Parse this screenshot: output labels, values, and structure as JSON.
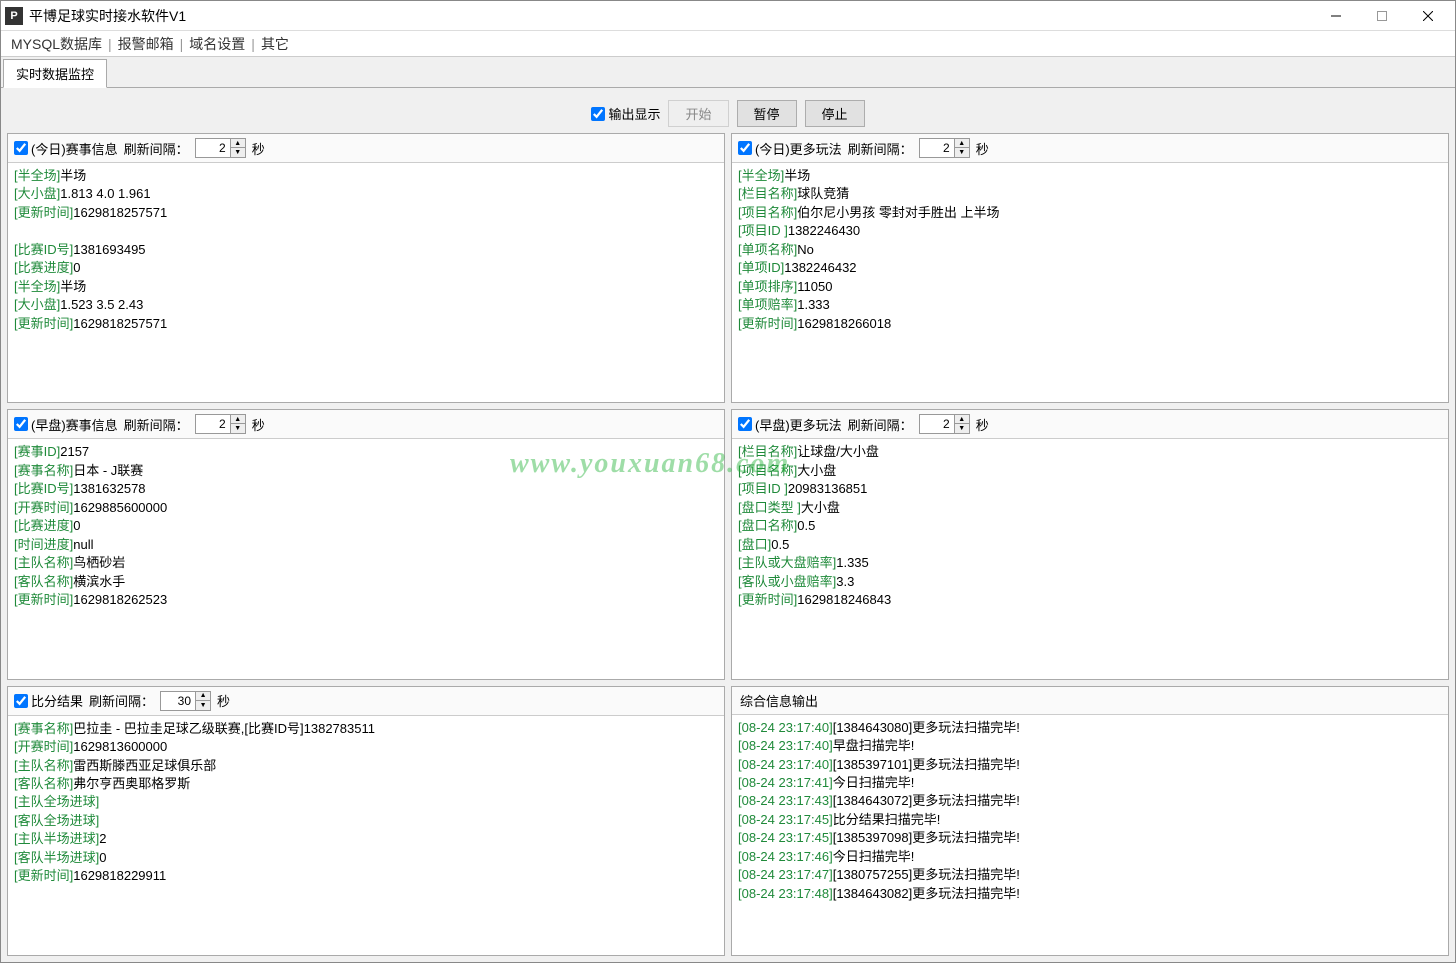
{
  "window": {
    "icon_letter": "P",
    "title": "平博足球实时接水软件V1"
  },
  "menu": {
    "items": [
      "MYSQL数据库",
      "报警邮箱",
      "域名设置",
      "其它"
    ]
  },
  "tab": {
    "active": "实时数据监控"
  },
  "top": {
    "output_display": "输出显示",
    "btn_start": "开始",
    "btn_pause": "暂停",
    "btn_stop": "停止"
  },
  "panels": {
    "today_match": {
      "title": "(今日)赛事信息",
      "interval_label": "刷新间隔：",
      "interval_val": "2",
      "unit": "秒",
      "lines": [
        {
          "k": "[半全场]",
          "v": "半场"
        },
        {
          "k": "[大小盘]",
          "v": "1.813 4.0 1.961"
        },
        {
          "k": "[更新时间]",
          "v": "1629818257571"
        },
        {
          "k": "",
          "v": ""
        },
        {
          "k": "[比赛ID号]",
          "v": "1381693495"
        },
        {
          "k": "[比赛进度]",
          "v": "0"
        },
        {
          "k": "[半全场]",
          "v": "半场"
        },
        {
          "k": "[大小盘]",
          "v": "1.523 3.5 2.43"
        },
        {
          "k": "[更新时间]",
          "v": "1629818257571"
        }
      ]
    },
    "today_more": {
      "title": "(今日)更多玩法",
      "interval_label": "刷新间隔：",
      "interval_val": "2",
      "unit": "秒",
      "lines": [
        {
          "k": "[半全场]",
          "v": "半场"
        },
        {
          "k": "[栏目名称]",
          "v": "球队竞猜"
        },
        {
          "k": "[项目名称]",
          "v": "伯尔尼小男孩 零封对手胜出 上半场"
        },
        {
          "k": "[项目ID ]",
          "v": "1382246430"
        },
        {
          "k": "[单项名称]",
          "v": "No"
        },
        {
          "k": "[单项ID]",
          "v": "1382246432"
        },
        {
          "k": "[单项排序]",
          "v": "11050"
        },
        {
          "k": "[单项赔率]",
          "v": "1.333"
        },
        {
          "k": "[更新时间]",
          "v": "1629818266018"
        }
      ]
    },
    "early_match": {
      "title": "(早盘)赛事信息",
      "interval_label": "刷新间隔：",
      "interval_val": "2",
      "unit": "秒",
      "lines": [
        {
          "k": "[赛事ID]",
          "v": "2157"
        },
        {
          "k": "[赛事名称]",
          "v": "日本 - J联赛"
        },
        {
          "k": "[比赛ID号]",
          "v": "1381632578"
        },
        {
          "k": "[开赛时间]",
          "v": "1629885600000"
        },
        {
          "k": "[比赛进度]",
          "v": "0"
        },
        {
          "k": "[时间进度]",
          "v": "null"
        },
        {
          "k": "[主队名称]",
          "v": "鸟栖砂岩"
        },
        {
          "k": "[客队名称]",
          "v": "横滨水手"
        },
        {
          "k": "[更新时间]",
          "v": "1629818262523"
        }
      ]
    },
    "early_more": {
      "title": "(早盘)更多玩法",
      "interval_label": "刷新间隔：",
      "interval_val": "2",
      "unit": "秒",
      "lines": [
        {
          "k": "[栏目名称]",
          "v": "让球盘/大小盘"
        },
        {
          "k": "[项目名称]",
          "v": "大小盘"
        },
        {
          "k": "[项目ID ]",
          "v": "20983136851"
        },
        {
          "k": "[盘口类型 ]",
          "v": "大小盘"
        },
        {
          "k": "[盘口名称]",
          "v": "0.5"
        },
        {
          "k": "[盘口]",
          "v": "0.5"
        },
        {
          "k": "[主队或大盘赔率]",
          "v": "1.335"
        },
        {
          "k": "[客队或小盘赔率]",
          "v": "3.3"
        },
        {
          "k": "[更新时间]",
          "v": "1629818246843"
        }
      ]
    },
    "score": {
      "title": "比分结果",
      "interval_label": "刷新间隔：",
      "interval_val": "30",
      "unit": "秒",
      "lines": [
        {
          "k": "[赛事名称]",
          "v": "巴拉圭 - 巴拉圭足球乙级联赛,[比赛ID号]1382783511"
        },
        {
          "k": "[开赛时间]",
          "v": "1629813600000"
        },
        {
          "k": "[主队名称]",
          "v": "雷西斯滕西亚足球俱乐部"
        },
        {
          "k": "[客队名称]",
          "v": "弗尔亨西奥耶格罗斯"
        },
        {
          "k": "[主队全场进球]",
          "v": ""
        },
        {
          "k": "[客队全场进球]",
          "v": ""
        },
        {
          "k": "[主队半场进球]",
          "v": "2"
        },
        {
          "k": "[客队半场进球]",
          "v": "0"
        },
        {
          "k": "[更新时间]",
          "v": "1629818229911"
        }
      ]
    },
    "output": {
      "title": "综合信息输出",
      "lines": [
        {
          "t": "[08-24 23:17:40]",
          "v": "[1384643080]更多玩法扫描完毕!"
        },
        {
          "t": "[08-24 23:17:40]",
          "v": "早盘扫描完毕!"
        },
        {
          "t": "[08-24 23:17:40]",
          "v": "[1385397101]更多玩法扫描完毕!"
        },
        {
          "t": "[08-24 23:17:41]",
          "v": "今日扫描完毕!"
        },
        {
          "t": "[08-24 23:17:43]",
          "v": "[1384643072]更多玩法扫描完毕!"
        },
        {
          "t": "[08-24 23:17:45]",
          "v": "比分结果扫描完毕!"
        },
        {
          "t": "[08-24 23:17:45]",
          "v": "[1385397098]更多玩法扫描完毕!"
        },
        {
          "t": "[08-24 23:17:46]",
          "v": "今日扫描完毕!"
        },
        {
          "t": "[08-24 23:17:47]",
          "v": "[1380757255]更多玩法扫描完毕!"
        },
        {
          "t": "[08-24 23:17:48]",
          "v": "[1384643082]更多玩法扫描完毕!"
        }
      ]
    }
  },
  "watermark": "www.youxuan68.com"
}
